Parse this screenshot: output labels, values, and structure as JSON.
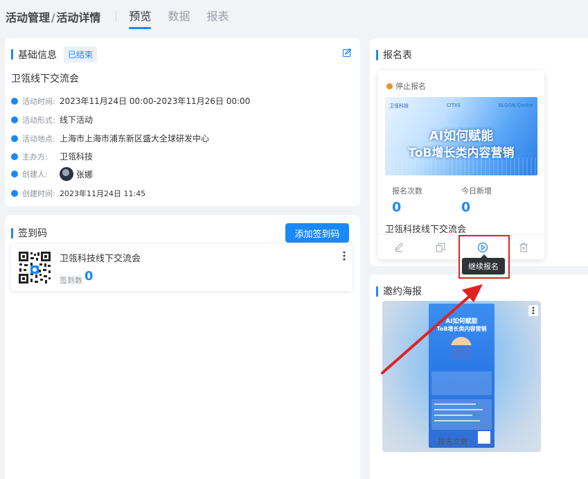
{
  "header": {
    "crumb_parent": "活动管理",
    "crumb_sep": "/",
    "crumb_current": "活动详情",
    "tabs": [
      {
        "label": "预览",
        "active": true
      },
      {
        "label": "数据",
        "active": false
      },
      {
        "label": "报表",
        "active": false
      }
    ]
  },
  "basic_info": {
    "title": "基础信息",
    "badge": "已结束",
    "event_name": "卫瓴线下交流会",
    "rows": [
      {
        "label": "活动时间:",
        "value": "2023年11月24日 00:00-2023年11月26日 00:00",
        "icon": "clock-icon"
      },
      {
        "label": "活动形式:",
        "value": "线下活动",
        "icon": "grid-icon"
      },
      {
        "label": "活动地点:",
        "value": "上海市上海市浦东新区盛大全球研发中心",
        "icon": "location-icon"
      },
      {
        "label": "主办方:",
        "value": "卫瓴科技",
        "icon": "group-icon"
      },
      {
        "label": "创建人:",
        "value": "张娜",
        "icon": "user-icon"
      },
      {
        "label": "创建时间:",
        "value": "2023年11月24日 11:45",
        "icon": "clock-icon"
      }
    ]
  },
  "checkin": {
    "title": "签到码",
    "add_button": "添加签到码",
    "item_title": "卫瓴科技线下交流会",
    "count_label": "签到数",
    "count_value": "0"
  },
  "registration": {
    "title": "报名表",
    "status": "停止报名",
    "banner_logo_1": "卫瓴科技",
    "banner_logo_2": "CITIIS",
    "banner_logo_3": "BLGGN Centre",
    "banner_line1": "AI如何赋能",
    "banner_line2": "ToB增长类内容营销",
    "stat1_label": "报名次数",
    "stat1_value": "0",
    "stat2_label": "今日新增",
    "stat2_value": "0",
    "name": "卫瓴科技线下交流会",
    "tooltip": "继续报名"
  },
  "poster": {
    "title": "邀约海报",
    "line1": "AI如何赋能",
    "line2": "ToB增长类内容营销",
    "count_label": "报名次数"
  },
  "colors": {
    "accent": "#1989fa",
    "status_stopped": "#f0902c",
    "highlight": "#e02222"
  }
}
